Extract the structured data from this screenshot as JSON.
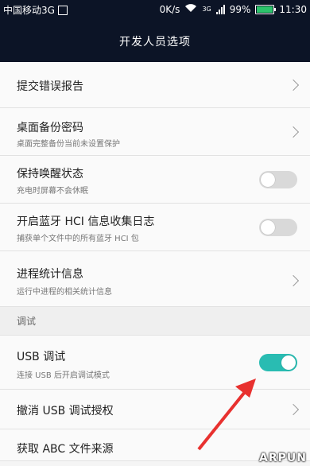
{
  "status": {
    "carrier": "中国移动3G",
    "speed": "0K/s",
    "network": "3G",
    "battery": "99%",
    "battery_level": 0.99,
    "time": "11:30"
  },
  "header": {
    "title": "开发人员选项"
  },
  "items": [
    {
      "title": "提交错误报告",
      "type": "nav"
    },
    {
      "title": "桌面备份密码",
      "subtitle": "桌面完整备份当前未设置保护",
      "type": "nav"
    },
    {
      "title": "保持唤醒状态",
      "subtitle": "充电时屏幕不会休眠",
      "type": "toggle",
      "on": false
    },
    {
      "title": "开启蓝牙 HCI 信息收集日志",
      "subtitle": "捕获单个文件中的所有蓝牙 HCI 包",
      "type": "toggle",
      "on": false
    },
    {
      "title": "进程统计信息",
      "subtitle": "运行中进程的相关统计信息",
      "type": "nav"
    }
  ],
  "section": {
    "label": "调试"
  },
  "debug_items": [
    {
      "title": "USB 调试",
      "subtitle": "连接 USB 后开启调试模式",
      "type": "toggle",
      "on": true
    },
    {
      "title": "撤消 USB 调试授权",
      "type": "nav"
    },
    {
      "title": "获取 ABC 文件来源",
      "type": "nav"
    }
  ],
  "watermark": "ARPUN",
  "colors": {
    "header_bg": "#0c1426",
    "toggle_on": "#29bcb2",
    "arrow": "#e8312f"
  }
}
